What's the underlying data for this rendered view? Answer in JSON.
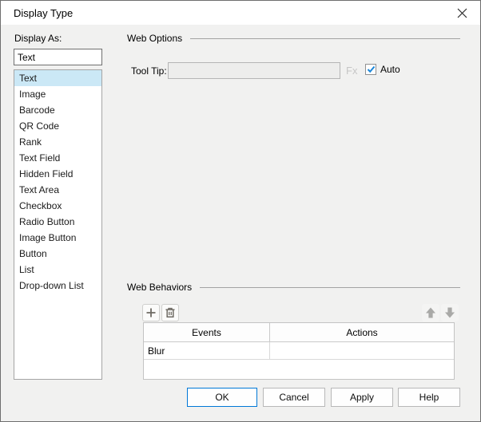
{
  "window": {
    "title": "Display Type"
  },
  "display_as": {
    "label": "Display As:",
    "value": "Text",
    "selected": "Text",
    "options": [
      "Text",
      "Image",
      "Barcode",
      "QR Code",
      "Rank",
      "Text Field",
      "Hidden Field",
      "Text Area",
      "Checkbox",
      "Radio Button",
      "Image Button",
      "Button",
      "List",
      "Drop-down List"
    ]
  },
  "web_options": {
    "title": "Web Options",
    "tooltip_label": "Tool Tip:",
    "tooltip_value": "",
    "fx_label": "Fx",
    "auto_label": "Auto",
    "auto_checked": true
  },
  "web_behaviors": {
    "title": "Web Behaviors",
    "headers": [
      "Events",
      "Actions"
    ],
    "rows": [
      {
        "event": "Blur",
        "action": ""
      }
    ]
  },
  "buttons": {
    "ok": "OK",
    "cancel": "Cancel",
    "apply": "Apply",
    "help": "Help"
  },
  "icons": {
    "close": "close-icon",
    "add": "plus-icon",
    "delete": "trash-icon",
    "move_up": "up-arrow-icon",
    "move_down": "down-arrow-icon",
    "auto_check": "check-icon"
  },
  "colors": {
    "accent": "#0078d7",
    "selection": "#cbe8f6",
    "disabled_text": "#c6c6c6",
    "titlebar_bg": "#ffffff",
    "dialog_bg": "#f1f1f0"
  }
}
